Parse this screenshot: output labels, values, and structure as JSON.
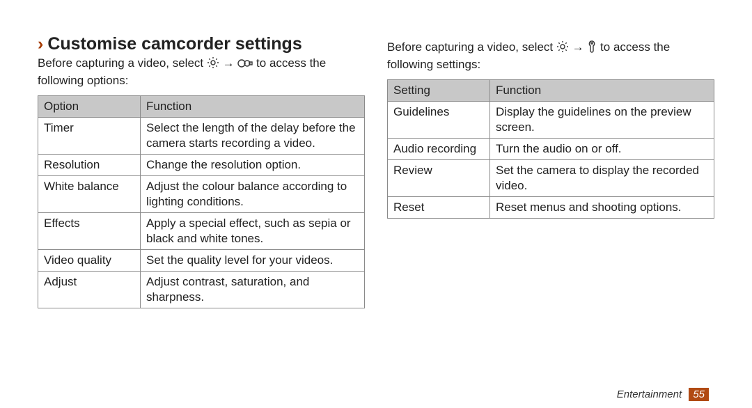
{
  "heading": "Customise camcorder settings",
  "intro_left_pre": "Before capturing a video, select ",
  "intro_left_mid": " → ",
  "intro_left_post": " to access the following options:",
  "intro_right_pre": "Before capturing a video, select ",
  "intro_right_mid": " → ",
  "intro_right_post": " to access the following settings:",
  "table1": {
    "head": [
      "Option",
      "Function"
    ],
    "rows": [
      [
        "Timer",
        "Select the length of the delay before the camera starts recording a video."
      ],
      [
        "Resolution",
        "Change the resolution option."
      ],
      [
        "White balance",
        "Adjust the colour balance according to lighting conditions."
      ],
      [
        "Effects",
        "Apply a special effect, such as sepia or black and white tones."
      ],
      [
        "Video quality",
        "Set the quality level for your videos."
      ],
      [
        "Adjust",
        "Adjust contrast, saturation, and sharpness."
      ]
    ]
  },
  "table2": {
    "head": [
      "Setting",
      "Function"
    ],
    "rows": [
      [
        "Guidelines",
        "Display the guidelines on the preview screen."
      ],
      [
        "Audio recording",
        "Turn the audio on or off."
      ],
      [
        "Review",
        "Set the camera to display the recorded video."
      ],
      [
        "Reset",
        "Reset menus and shooting options."
      ]
    ]
  },
  "footer": {
    "section": "Entertainment",
    "page": "55"
  },
  "icons": {
    "gear": "gear-icon",
    "camcorder": "camcorder-icon",
    "wrench": "wrench-icon"
  }
}
